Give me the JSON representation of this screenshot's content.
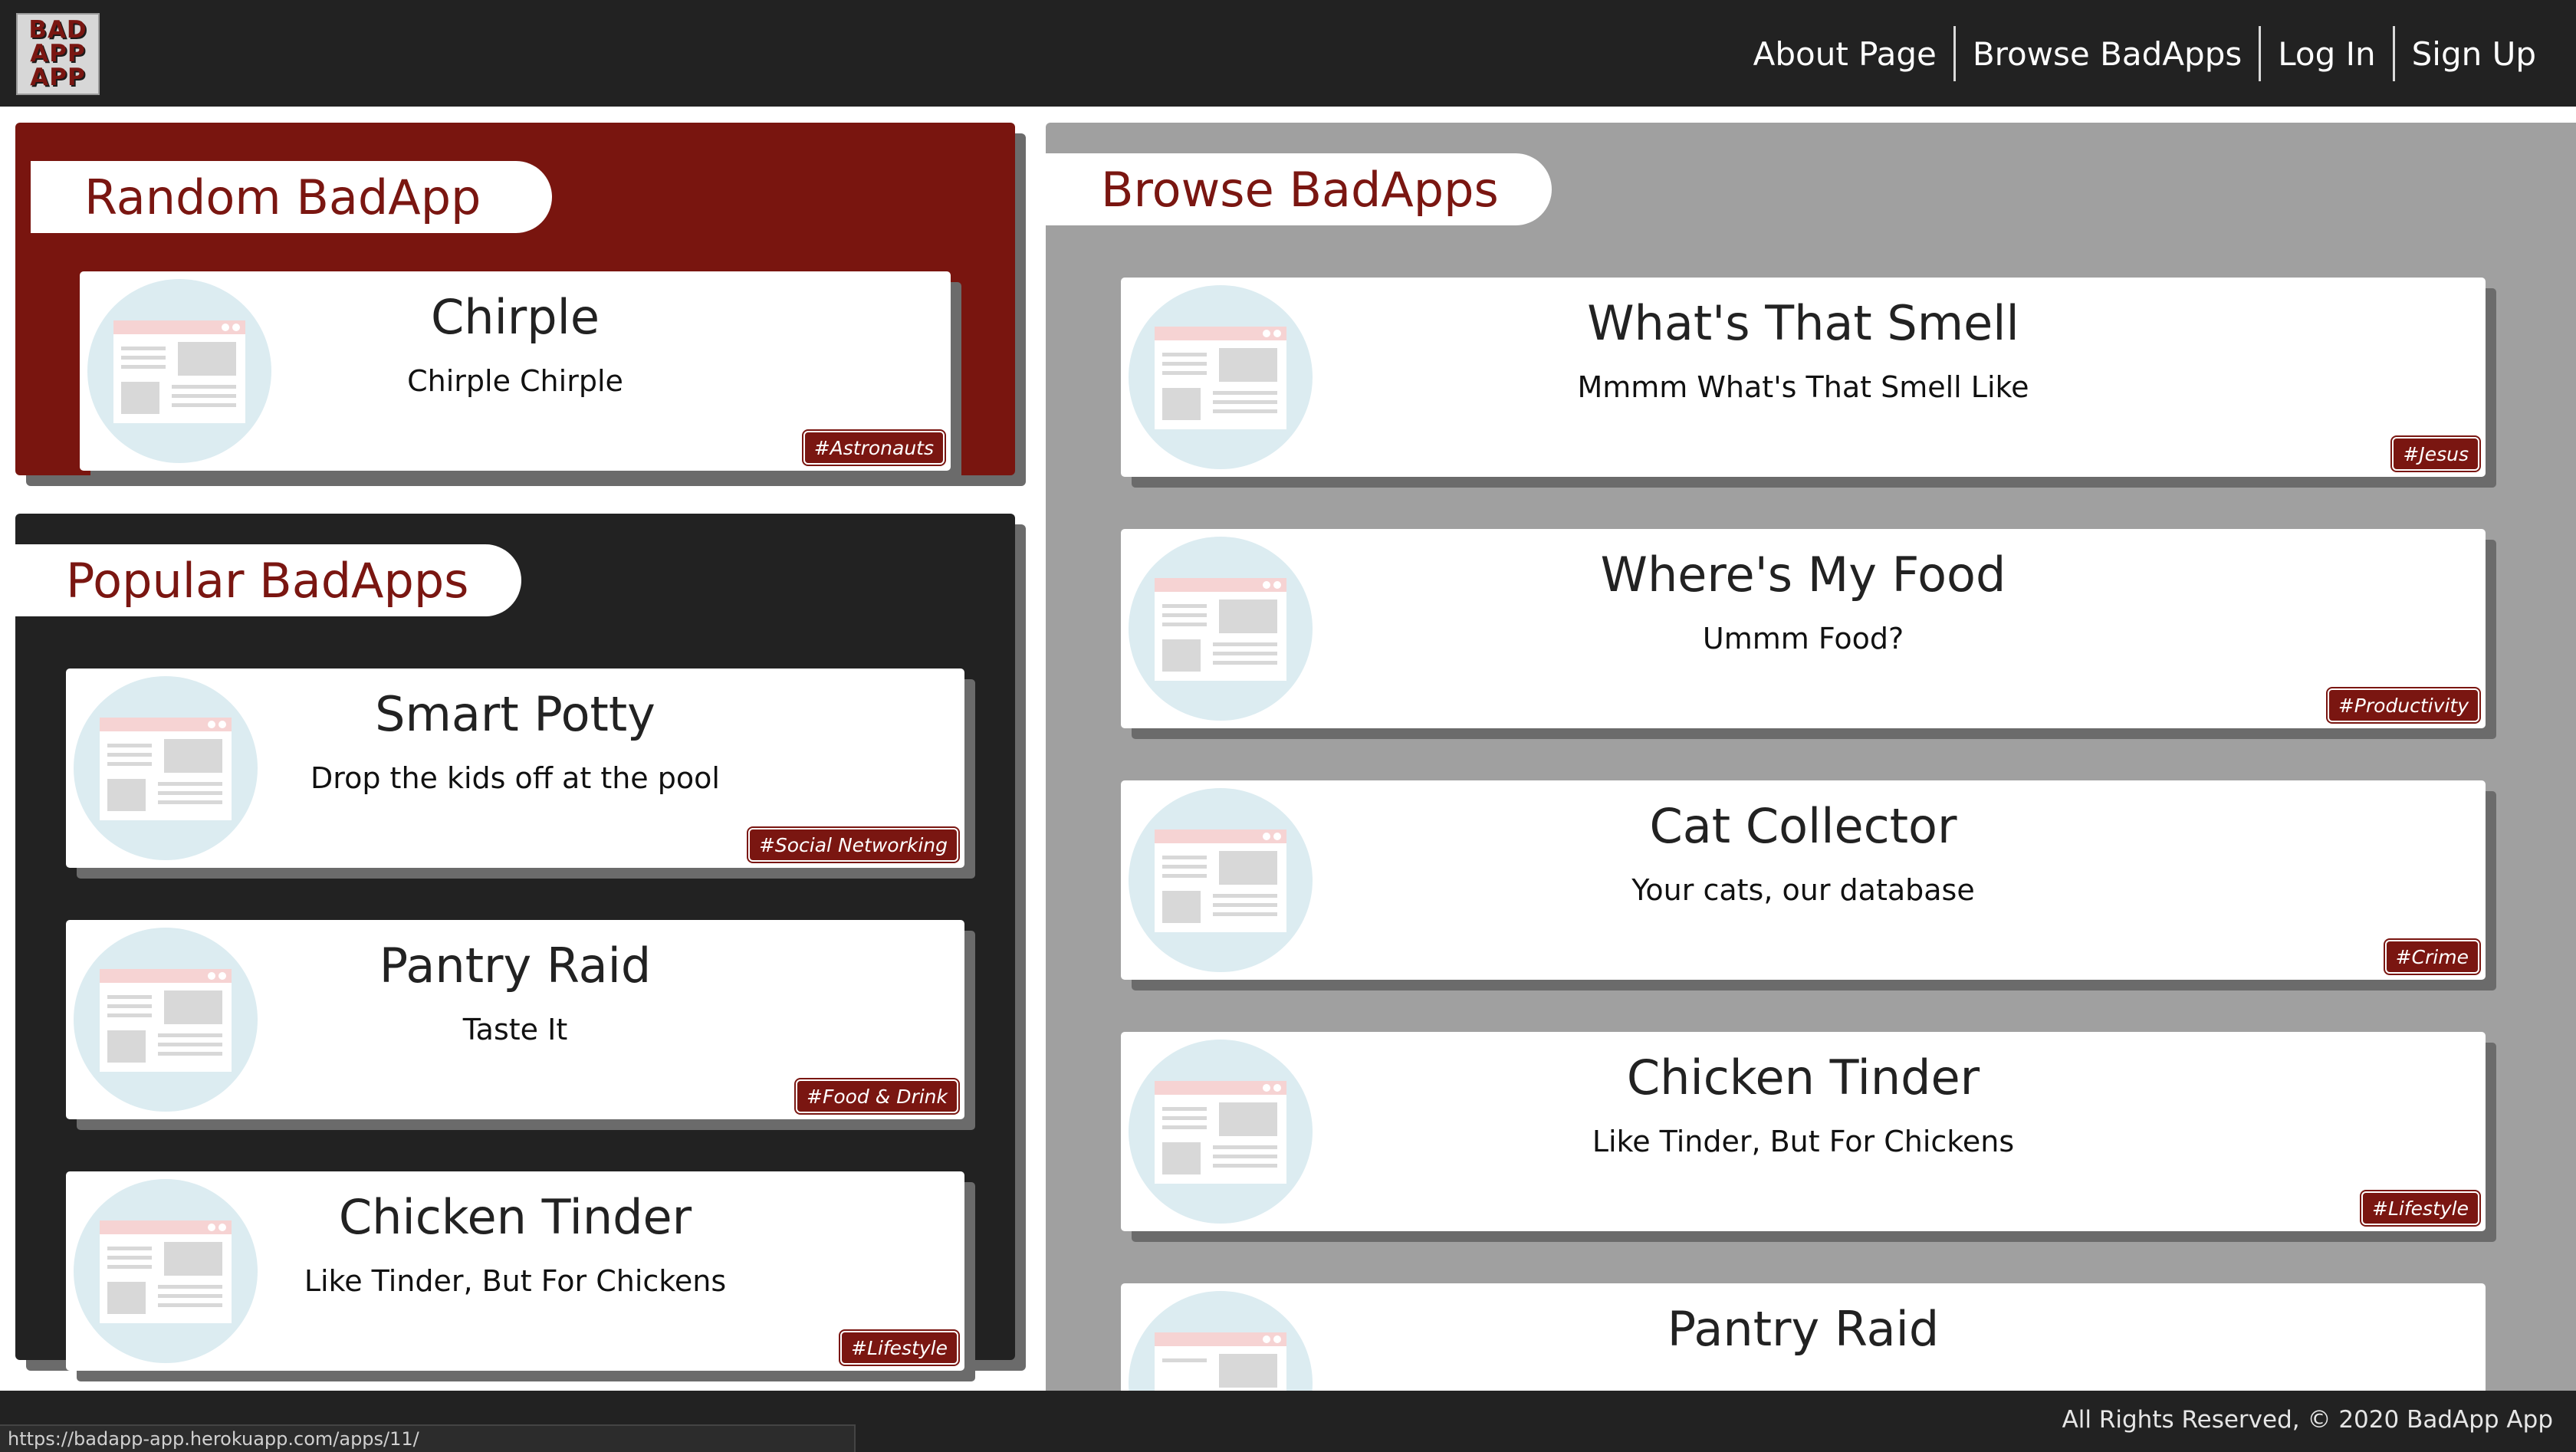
{
  "app": {
    "logo_lines": [
      "BAD",
      "APP",
      "APP"
    ]
  },
  "nav": {
    "items": [
      {
        "label": "About Page"
      },
      {
        "label": "Browse BadApps"
      },
      {
        "label": "Log In"
      },
      {
        "label": "Sign Up"
      }
    ]
  },
  "random": {
    "title": "Random BadApp",
    "card": {
      "name": "Chirple",
      "desc": "Chirple Chirple",
      "tag": "#Astronauts"
    }
  },
  "popular": {
    "title": "Popular BadApps",
    "cards": [
      {
        "name": "Smart Potty",
        "desc": "Drop the kids off at the pool",
        "tag": "#Social Networking"
      },
      {
        "name": "Pantry Raid",
        "desc": "Taste It",
        "tag": "#Food & Drink"
      },
      {
        "name": "Chicken Tinder",
        "desc": "Like Tinder, But For Chickens",
        "tag": "#Lifestyle"
      }
    ]
  },
  "browse": {
    "title": "Browse BadApps",
    "cards": [
      {
        "name": "What's That Smell",
        "desc": "Mmmm What's That Smell Like",
        "tag": "#Jesus"
      },
      {
        "name": "Where's My Food",
        "desc": "Ummm Food?",
        "tag": "#Productivity"
      },
      {
        "name": "Cat Collector",
        "desc": "Your cats, our database",
        "tag": "#Crime"
      },
      {
        "name": "Chicken Tinder",
        "desc": "Like Tinder, But For Chickens",
        "tag": "#Lifestyle"
      },
      {
        "name": "Pantry Raid",
        "desc": "",
        "tag": ""
      }
    ]
  },
  "footer": {
    "copyright": "All Rights Reserved, © 2020 BadApp App"
  },
  "status_bar": {
    "url": "https://badapp-app.herokuapp.com/apps/11/"
  },
  "colors": {
    "brand_red": "#7a1611",
    "dark": "#222222",
    "panel_gray": "#a0a0a0",
    "thumb_bg": "#dcecf1"
  }
}
